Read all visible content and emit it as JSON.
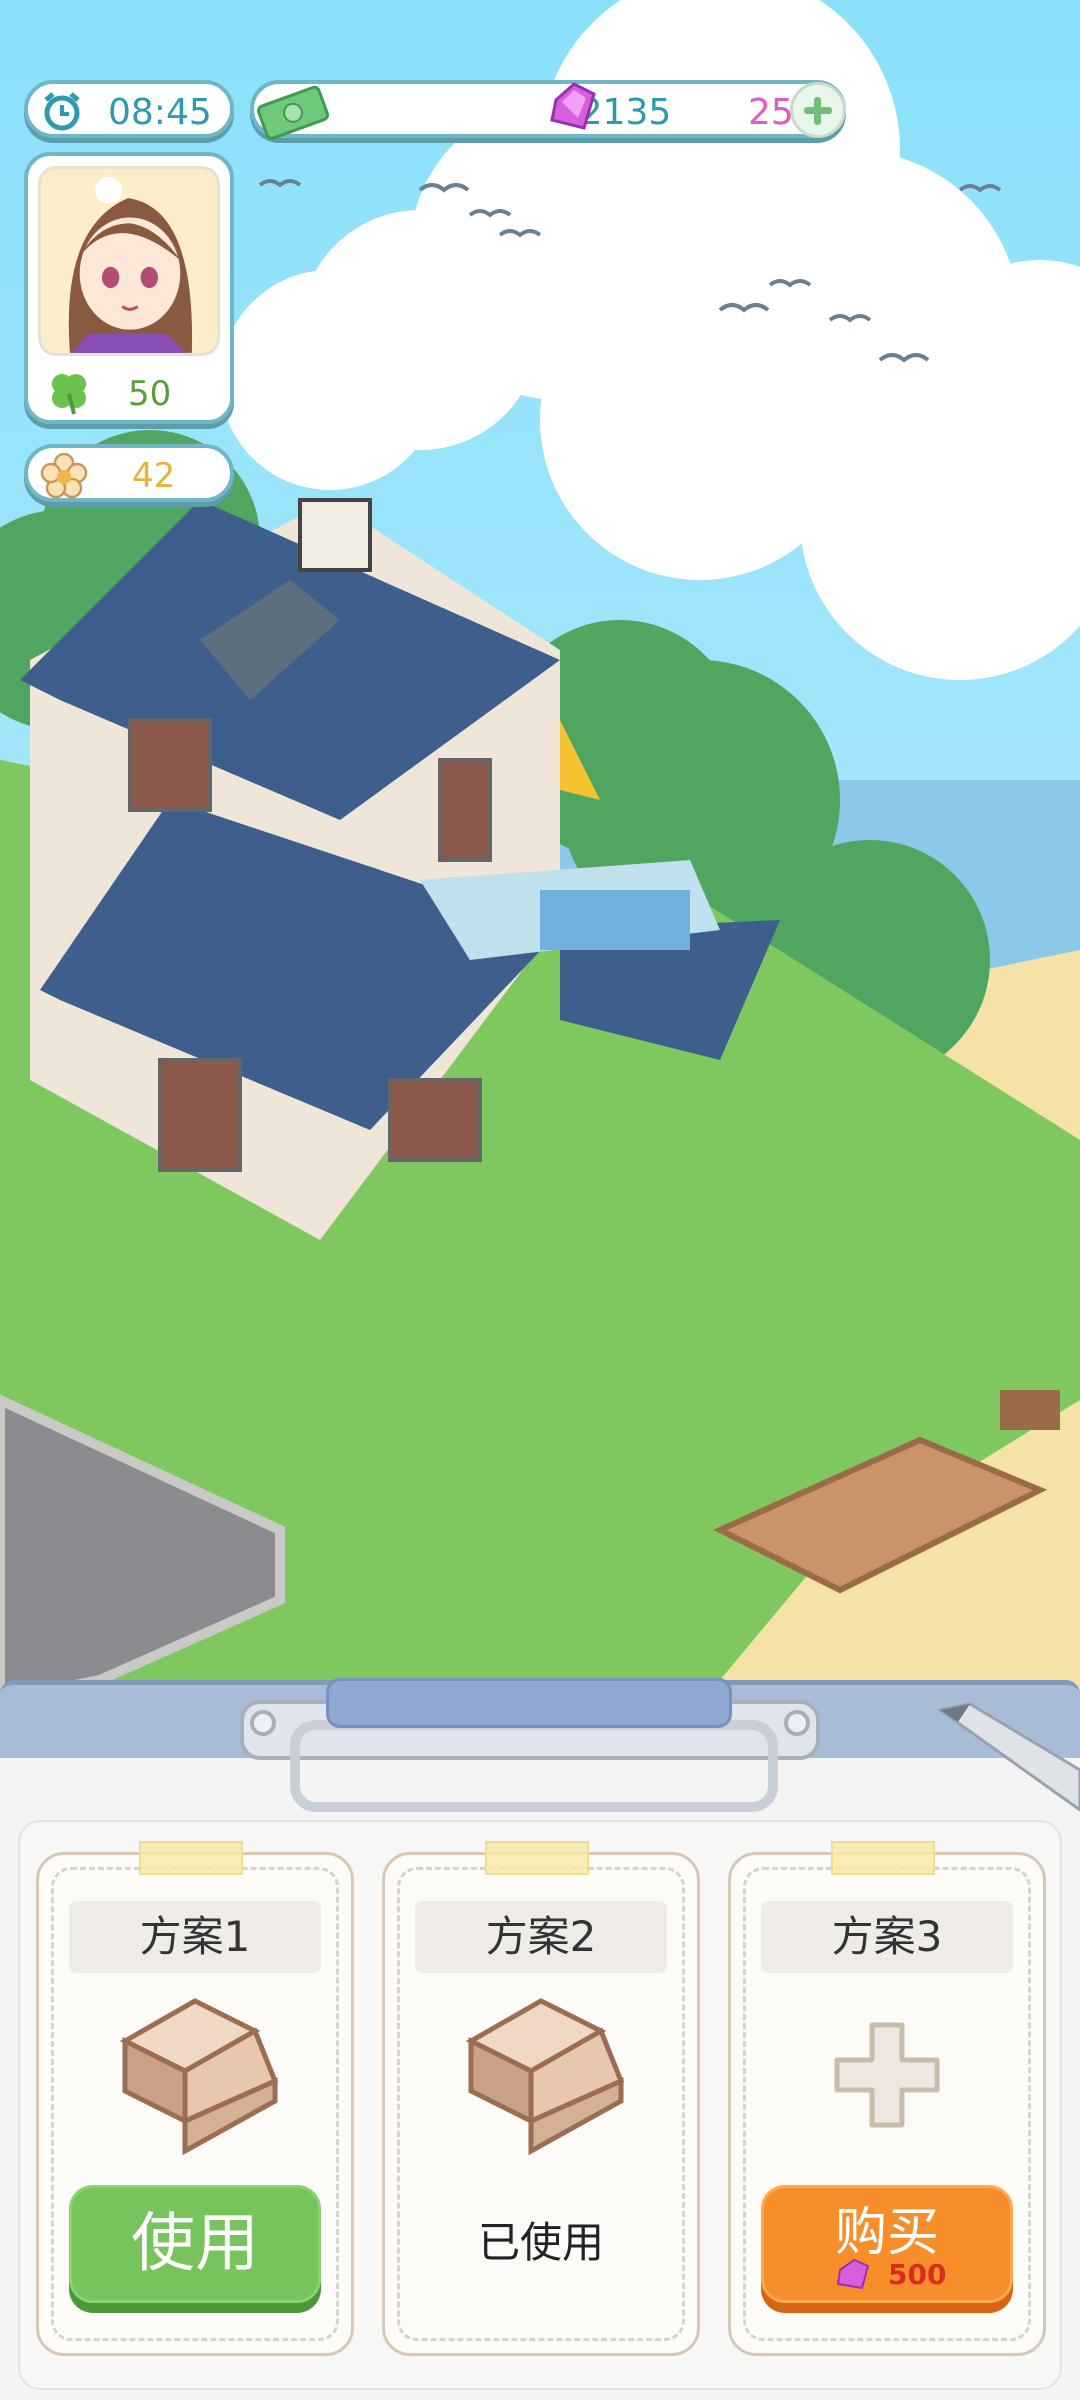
{
  "hud": {
    "time": "08:45",
    "money": "12135",
    "gems": "25",
    "clover_count": "50",
    "flower_count": "42"
  },
  "plans": [
    {
      "title": "方案1",
      "action": "使用",
      "state": "use"
    },
    {
      "title": "方案2",
      "action": "已使用",
      "state": "used"
    },
    {
      "title": "方案3",
      "action": "购买",
      "price": "500",
      "state": "buy"
    }
  ],
  "colors": {
    "accent": "#6fb6c7",
    "use_button": "#77c35c",
    "buy_button": "#f78e2a",
    "price": "#d82c1f"
  }
}
